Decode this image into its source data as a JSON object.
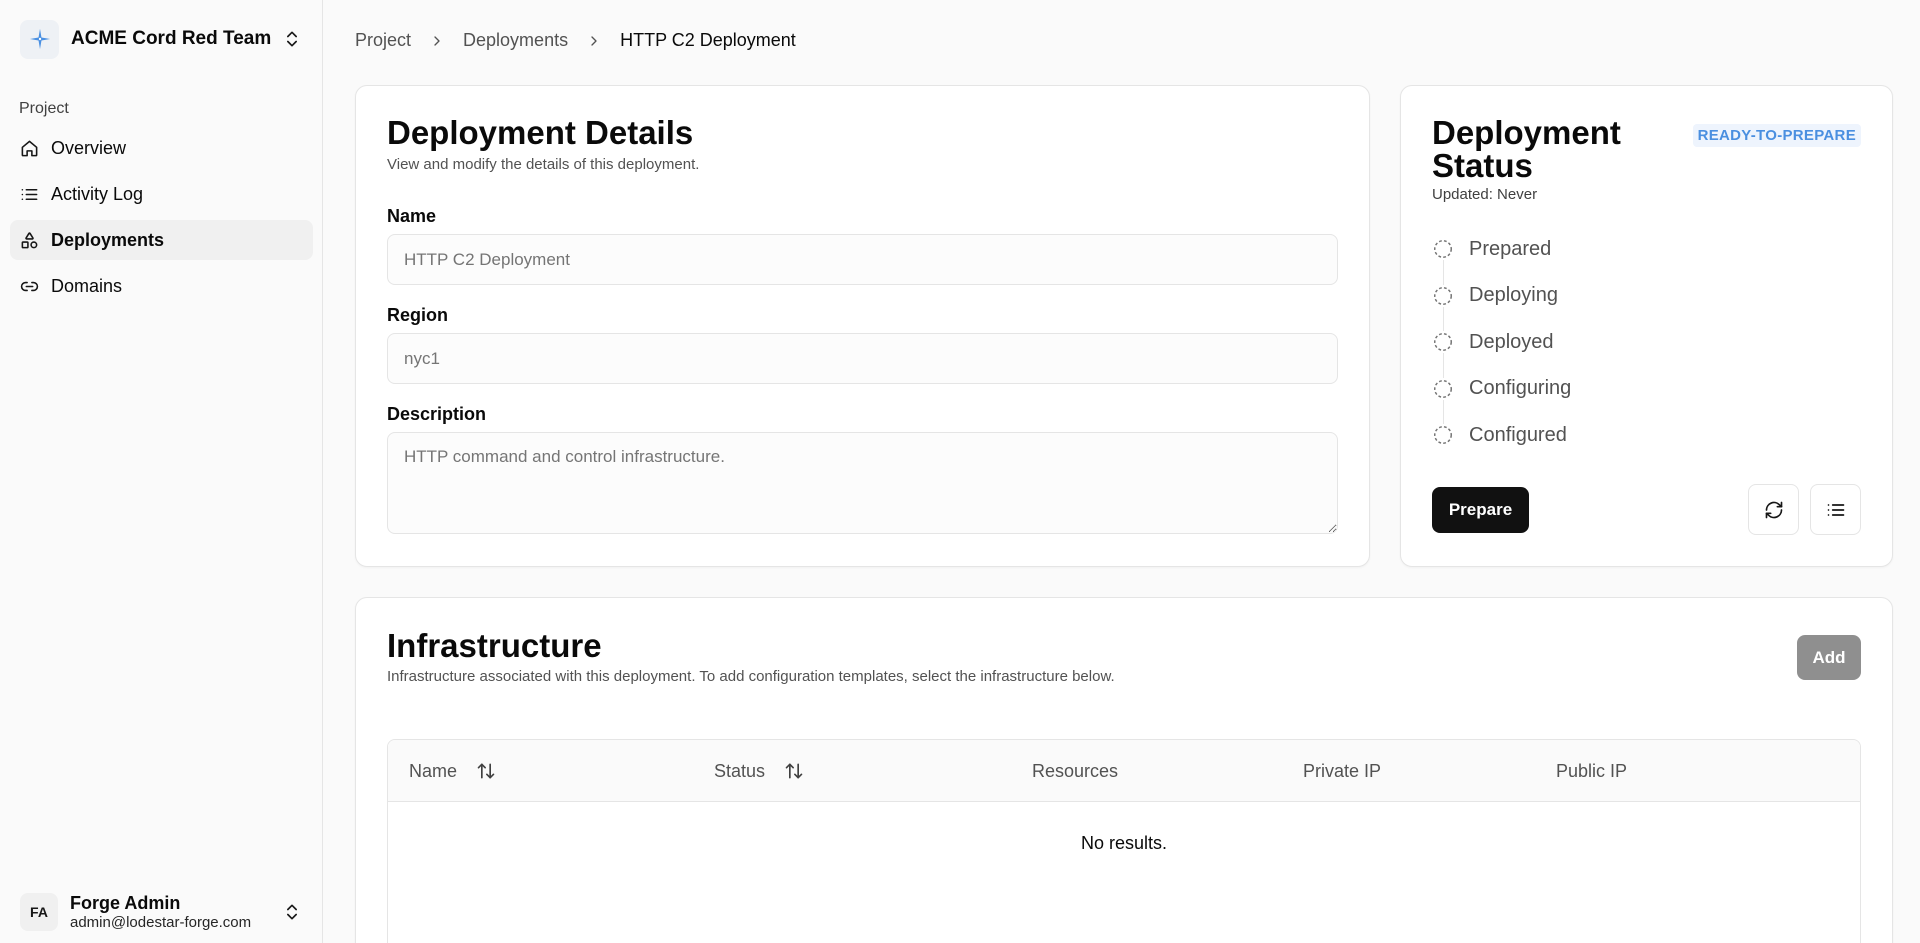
{
  "sidebar": {
    "team_name": "ACME Cord Red Team",
    "group_label": "Project",
    "items": [
      {
        "label": "Overview",
        "icon": "home-icon"
      },
      {
        "label": "Activity Log",
        "icon": "list-icon"
      },
      {
        "label": "Deployments",
        "icon": "shapes-icon",
        "active": true
      },
      {
        "label": "Domains",
        "icon": "link-icon"
      }
    ],
    "user": {
      "initials": "FA",
      "name": "Forge Admin",
      "email": "admin@lodestar-forge.com"
    }
  },
  "breadcrumb": [
    "Project",
    "Deployments",
    "HTTP C2 Deployment"
  ],
  "details": {
    "title": "Deployment Details",
    "description": "View and modify the details of this deployment.",
    "name_label": "Name",
    "name_placeholder": "HTTP C2 Deployment",
    "region_label": "Region",
    "region_placeholder": "nyc1",
    "description_label": "Description",
    "description_placeholder": "HTTP command and control infrastructure."
  },
  "status": {
    "title": "Deployment Status",
    "badge": "READY-TO-PREPARE",
    "updated": "Updated: Never",
    "steps": [
      "Prepared",
      "Deploying",
      "Deployed",
      "Configuring",
      "Configured"
    ],
    "prepare_label": "Prepare"
  },
  "infrastructure": {
    "title": "Infrastructure",
    "description": "Infrastructure associated with this deployment. To add configuration templates, select the infrastructure below.",
    "add_label": "Add",
    "columns": [
      "Name",
      "Status",
      "Resources",
      "Private IP",
      "Public IP"
    ],
    "empty_text": "No results."
  },
  "colors": {
    "badge": "#4a8fe0",
    "primary_button": "#111111",
    "add_button": "#8f8f8f",
    "logo_star": "#4a90e2"
  }
}
